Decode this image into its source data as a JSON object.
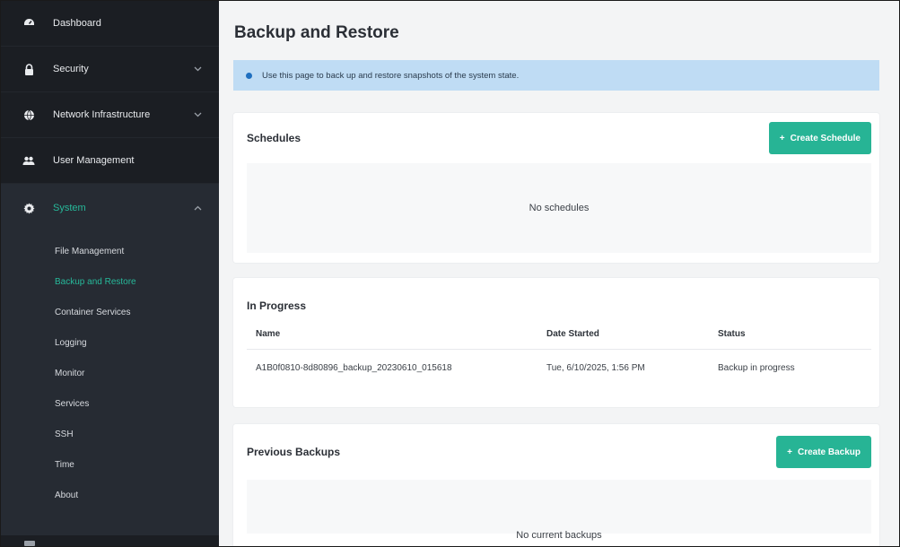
{
  "sidebar": {
    "top_items": [
      {
        "label": "Dashboard",
        "icon": "dashboard-icon",
        "has_chevron": false
      },
      {
        "label": "Security",
        "icon": "lock-icon",
        "has_chevron": true
      },
      {
        "label": "Network Infrastructure",
        "icon": "globe-icon",
        "has_chevron": true
      },
      {
        "label": "User Management",
        "icon": "users-icon",
        "has_chevron": false
      }
    ],
    "active_parent": {
      "label": "System",
      "icon": "gear-icon",
      "expanded": true
    },
    "sub_items": [
      {
        "label": "File Management",
        "active": false
      },
      {
        "label": "Backup and Restore",
        "active": true
      },
      {
        "label": "Container Services",
        "active": false
      },
      {
        "label": "Logging",
        "active": false
      },
      {
        "label": "Monitor",
        "active": false
      },
      {
        "label": "Services",
        "active": false
      },
      {
        "label": "SSH",
        "active": false
      },
      {
        "label": "Time",
        "active": false
      },
      {
        "label": "About",
        "active": false
      }
    ]
  },
  "page": {
    "title": "Backup and Restore",
    "info": "Use this page to back up and restore snapshots of the system state."
  },
  "schedules": {
    "title": "Schedules",
    "create_label": "Create Schedule",
    "empty_text": "No schedules"
  },
  "in_progress": {
    "title": "In Progress",
    "columns": [
      "Name",
      "Date Started",
      "Status"
    ],
    "rows": [
      {
        "name": "A1B0f0810-8d80896_backup_20230610_015618",
        "date_started": "Tue, 6/10/2025, 1:56 PM",
        "status": "Backup in progress"
      }
    ]
  },
  "previous_backups": {
    "title": "Previous Backups",
    "create_label": "Create Backup",
    "empty_text": "No current backups"
  },
  "colors": {
    "accent": "#27b495",
    "sidebar_bg": "#262b33",
    "sidebar_top_bg": "#1b1e23",
    "info_bg": "#bfdcf4",
    "active_text": "#26b99a"
  }
}
